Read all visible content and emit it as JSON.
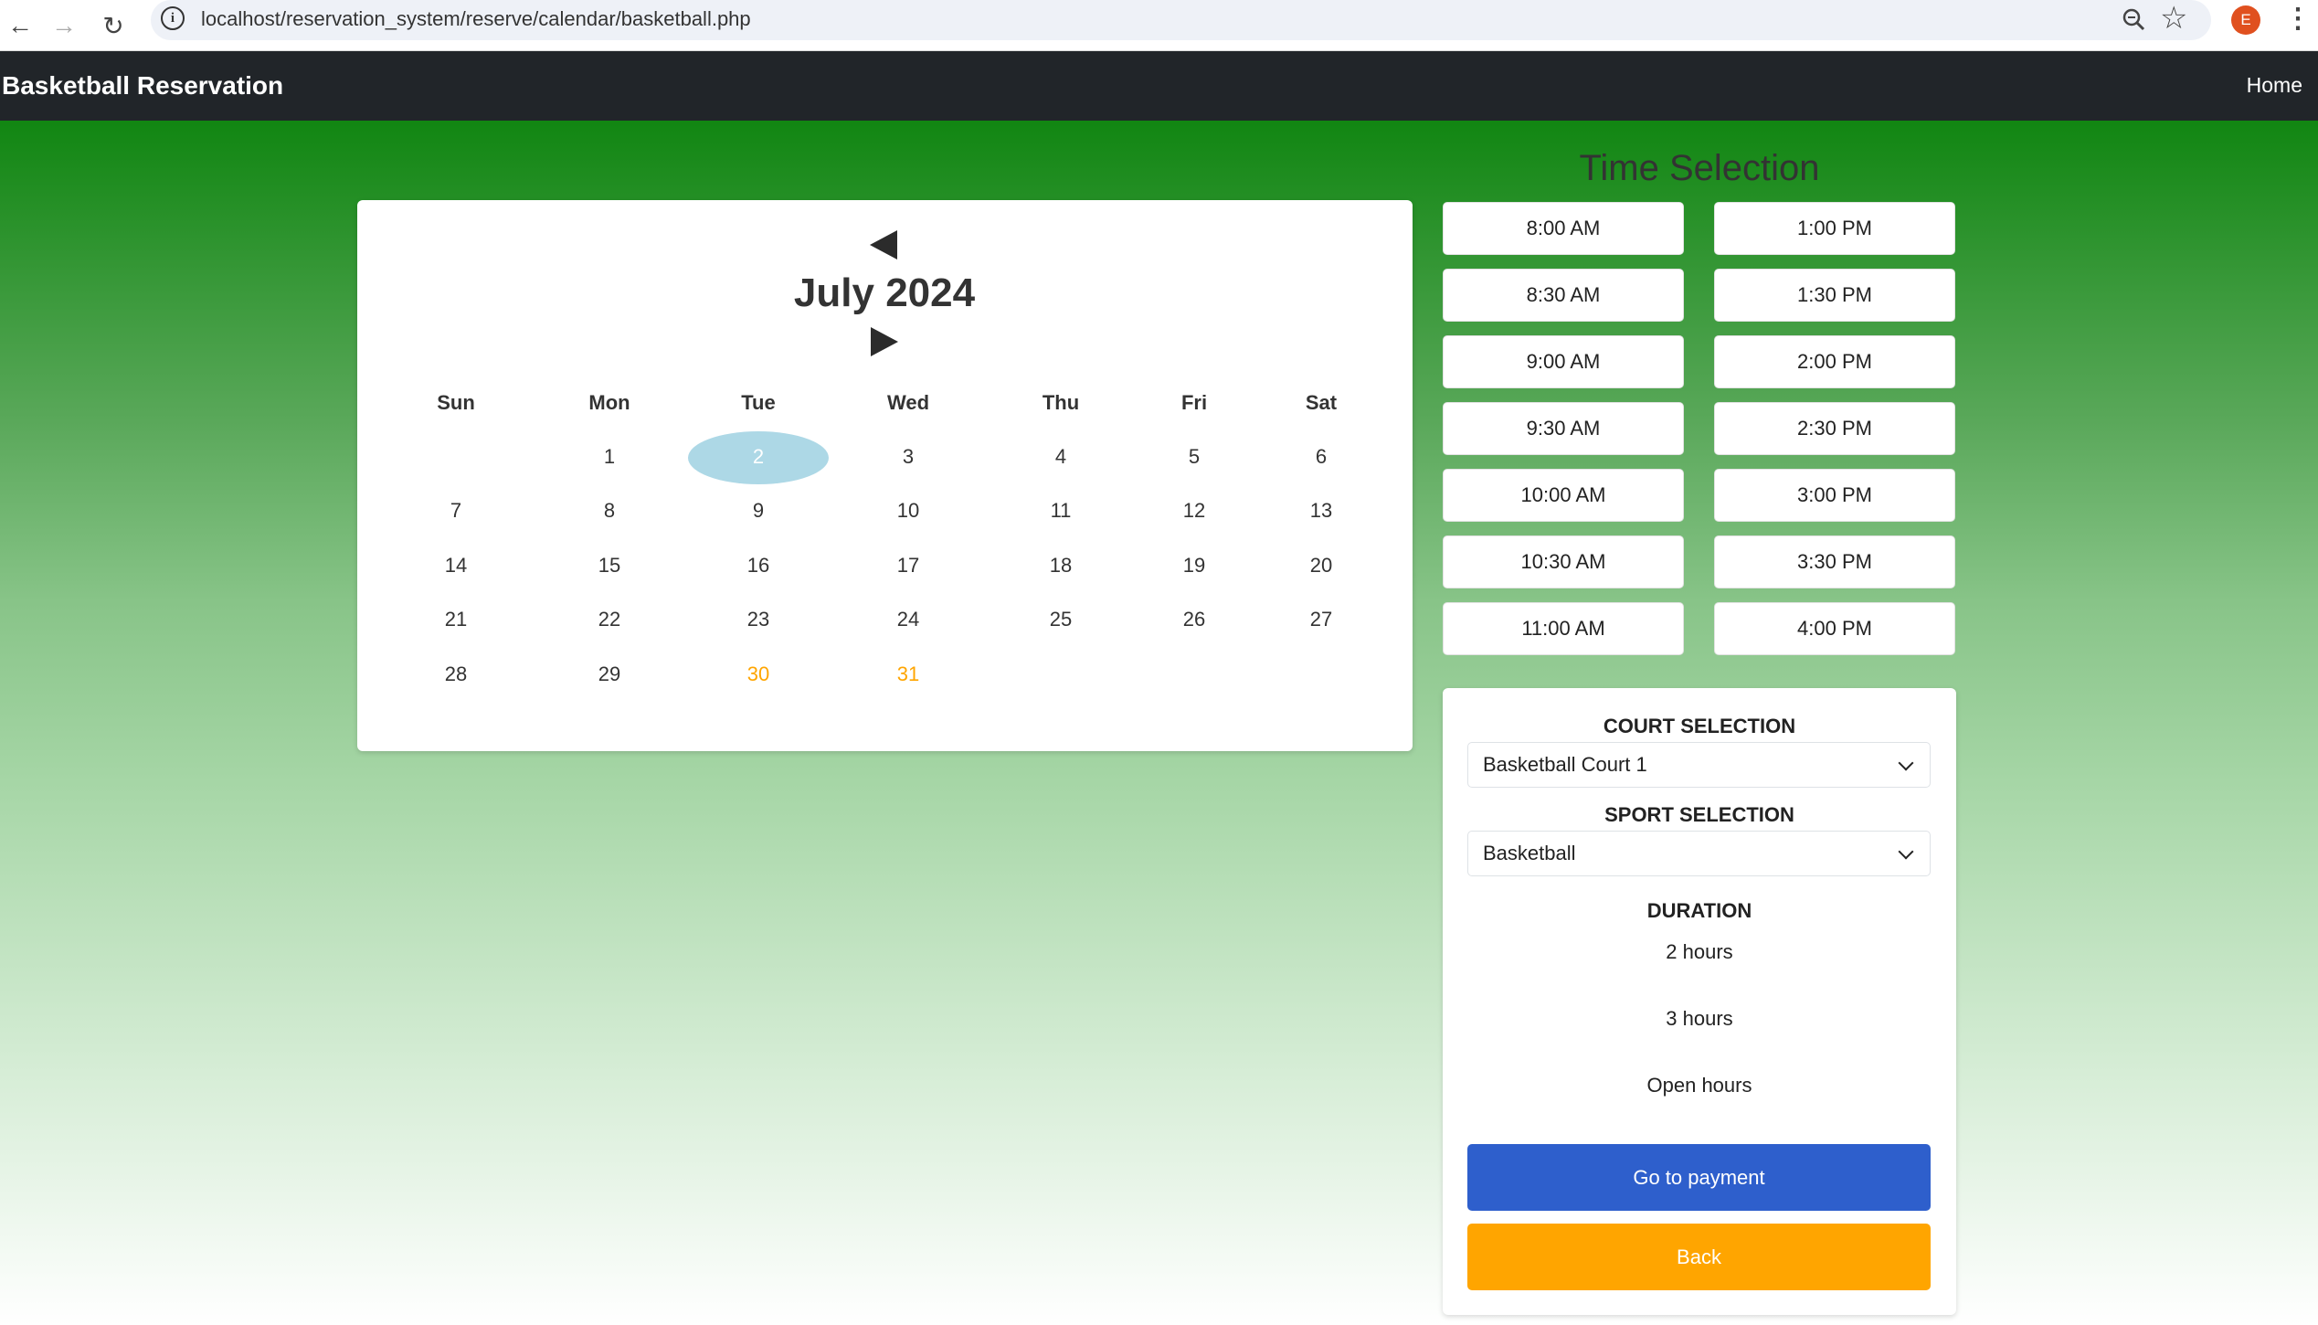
{
  "browser": {
    "url": "localhost/reservation_system/reserve/calendar/basketball.php",
    "profile_initial": "E"
  },
  "navbar": {
    "brand": "Basketball Reservation",
    "home": "Home"
  },
  "calendar": {
    "month_title": "July 2024",
    "weekdays": [
      "Sun",
      "Mon",
      "Tue",
      "Wed",
      "Thu",
      "Fri",
      "Sat"
    ],
    "days": [
      "1",
      "2",
      "3",
      "4",
      "5",
      "6",
      "7",
      "8",
      "9",
      "10",
      "11",
      "12",
      "13",
      "14",
      "15",
      "16",
      "17",
      "18",
      "19",
      "20",
      "21",
      "22",
      "23",
      "24",
      "25",
      "26",
      "27",
      "28",
      "29",
      "30",
      "31"
    ],
    "first_weekday": 1,
    "selected_day": "2",
    "highlighted_days": [
      "30",
      "31"
    ],
    "colors": {
      "selected": "#add8e6",
      "highlight": "#ffa500"
    }
  },
  "time_selection": {
    "title": "Time Selection",
    "morning": [
      "8:00 AM",
      "8:30 AM",
      "9:00 AM",
      "9:30 AM",
      "10:00 AM",
      "10:30 AM",
      "11:00 AM"
    ],
    "afternoon": [
      "1:00 PM",
      "1:30 PM",
      "2:00 PM",
      "2:30 PM",
      "3:00 PM",
      "3:30 PM",
      "4:00 PM"
    ]
  },
  "options": {
    "court_label": "COURT SELECTION",
    "court_value": "Basketball Court 1",
    "sport_label": "SPORT SELECTION",
    "sport_value": "Basketball",
    "duration_label": "DURATION",
    "durations": [
      "2 hours",
      "3 hours",
      "Open hours"
    ],
    "pay_button": "Go to payment",
    "back_button": "Back"
  },
  "colors": {
    "navbar": "#212529",
    "pay": "#2e5fcc",
    "back": "#ffa500",
    "bg_top": "#118612"
  }
}
